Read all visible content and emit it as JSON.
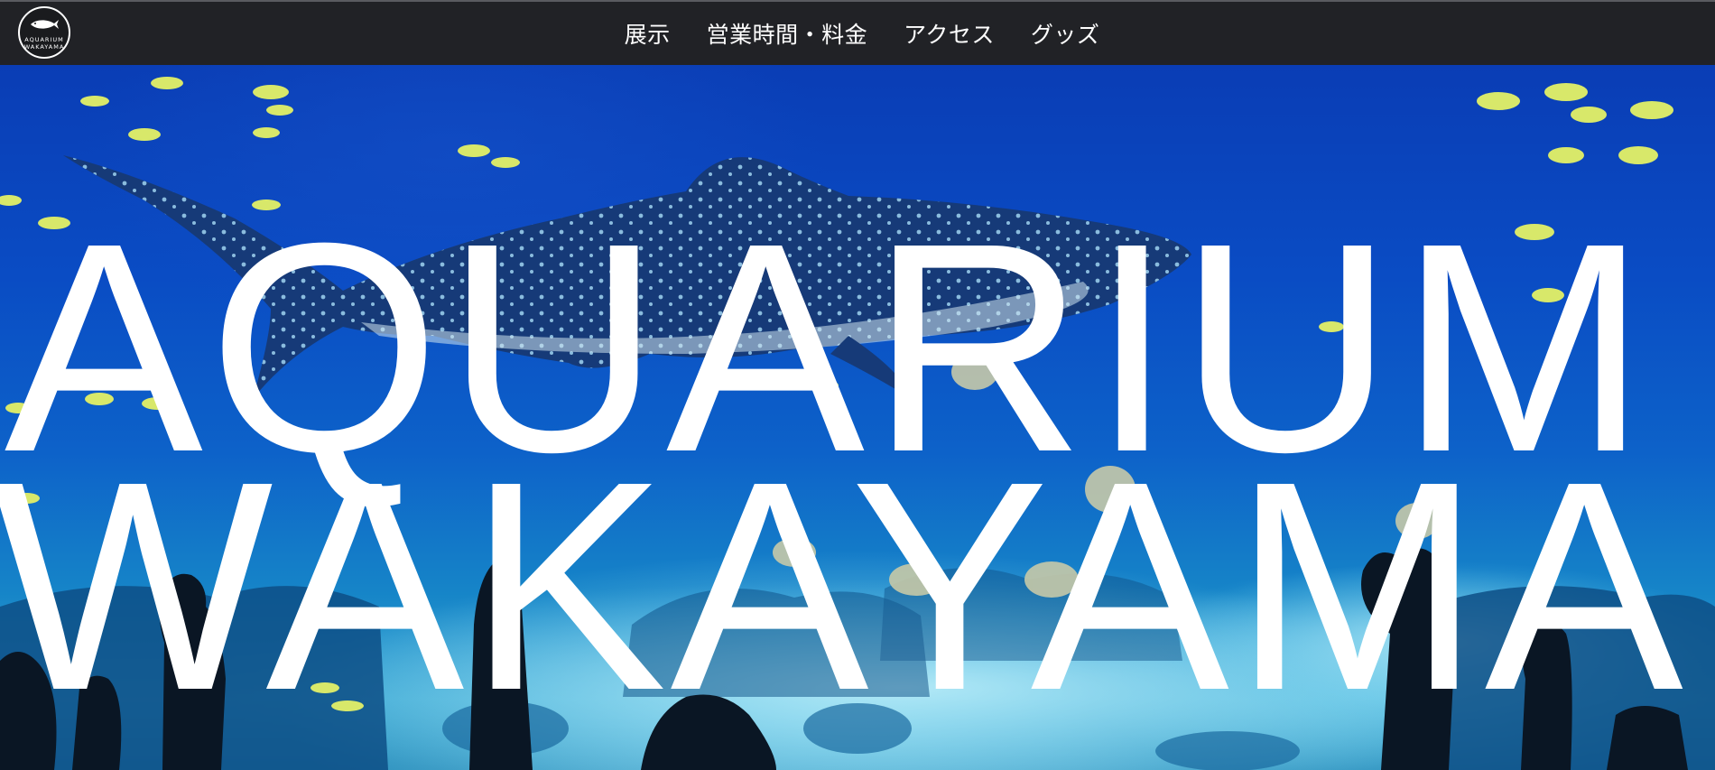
{
  "brand": {
    "logo_line1": "AQUARIUM",
    "logo_line2": "WAKAYAMA",
    "logo_icon": "fish-icon"
  },
  "nav": {
    "items": [
      {
        "label": "展示"
      },
      {
        "label": "営業時間・料金"
      },
      {
        "label": "アクセス"
      },
      {
        "label": "グッズ"
      }
    ]
  },
  "hero": {
    "line1": "AQUARIUM",
    "line2": "WAKAYAMA",
    "image": "whale-shark-aquarium-photo"
  },
  "colors": {
    "header_bg": "#212226",
    "text": "#ffffff",
    "water_deep": "#0a3db5",
    "water_light": "#3aa6d2"
  }
}
